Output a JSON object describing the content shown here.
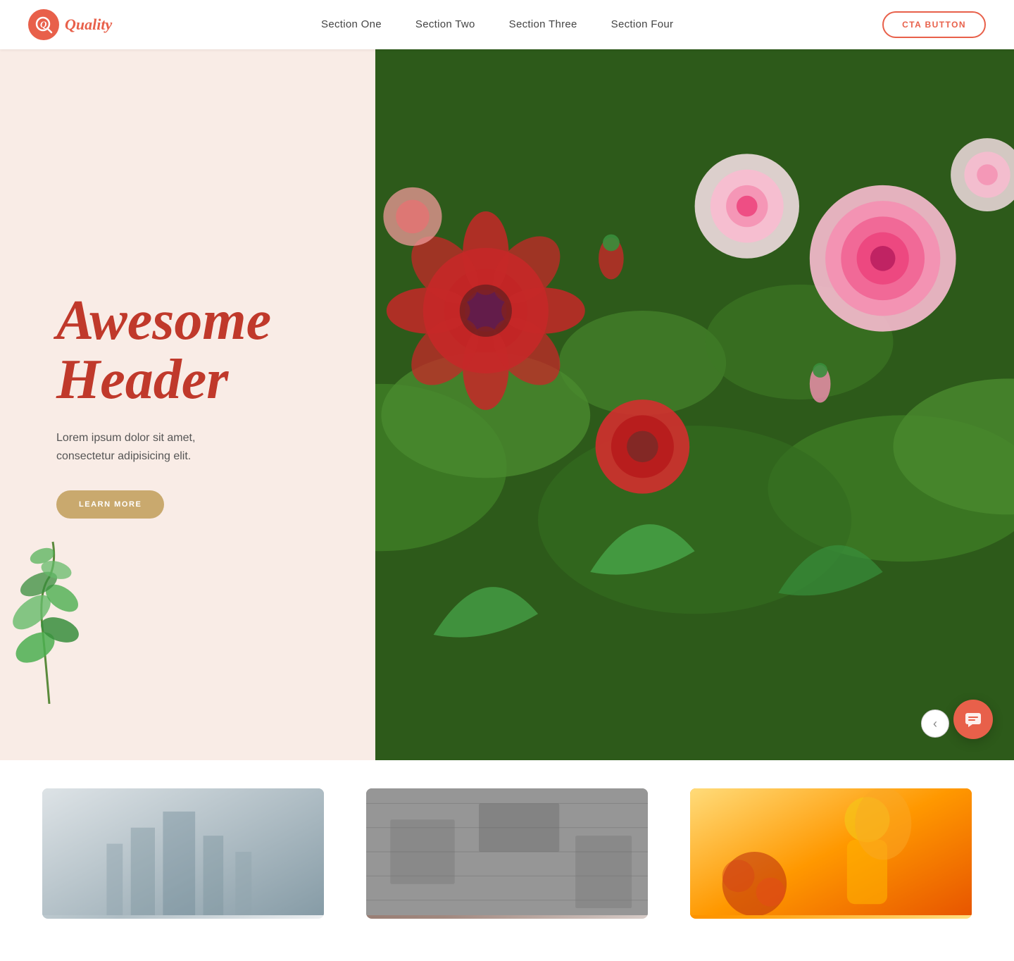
{
  "nav": {
    "logo_text": "Quality",
    "links": [
      {
        "label": "Section One",
        "id": "section-one"
      },
      {
        "label": "Section Two",
        "id": "section-two"
      },
      {
        "label": "Section Three",
        "id": "section-three"
      },
      {
        "label": "Section Four",
        "id": "section-four"
      }
    ],
    "cta_label": "CTA BUTTON"
  },
  "hero": {
    "heading_line1": "Awesome",
    "heading_line2": "Header",
    "subtext": "Lorem ipsum dolor sit amet, consectetur adipisicing elit.",
    "learn_more_label": "LEARN MORE"
  },
  "slider": {
    "prev_label": "‹",
    "next_label": "›"
  },
  "colors": {
    "brand": "#e8604a",
    "heading": "#c0392b",
    "bg": "#f9ece6",
    "btn_gold": "#c9a96e"
  }
}
